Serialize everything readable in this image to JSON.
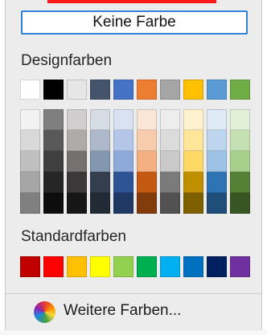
{
  "no_color_label": "Keine Farbe",
  "design_title": "Designfarben",
  "standard_title": "Standardfarben",
  "more_colors_label": "Weitere Farben...",
  "theme_colors": [
    {
      "name": "white",
      "base": "#ffffff",
      "shades": [
        "#f2f2f2",
        "#d9d9d9",
        "#bfbfbf",
        "#a6a6a6",
        "#808080"
      ]
    },
    {
      "name": "black",
      "base": "#000000",
      "shades": [
        "#7f7f7f",
        "#595959",
        "#3f3f3f",
        "#262626",
        "#0d0d0d"
      ]
    },
    {
      "name": "light-gray",
      "base": "#e7e6e6",
      "shades": [
        "#d0cece",
        "#aeabab",
        "#757171",
        "#3a3838",
        "#171616"
      ]
    },
    {
      "name": "dark-blue-gray",
      "base": "#44546a",
      "shades": [
        "#d6dce4",
        "#adb9ca",
        "#8497b0",
        "#333f4f",
        "#222b35"
      ]
    },
    {
      "name": "blue",
      "base": "#4472c4",
      "shades": [
        "#d9e2f3",
        "#b4c6e7",
        "#8eaadb",
        "#2f5496",
        "#1f3864"
      ]
    },
    {
      "name": "orange",
      "base": "#ed7d31",
      "shades": [
        "#fbe5d5",
        "#f7cbac",
        "#f4b083",
        "#c45911",
        "#823b0b"
      ]
    },
    {
      "name": "gray",
      "base": "#a5a5a5",
      "shades": [
        "#ededed",
        "#dbdbdb",
        "#c9c9c9",
        "#7b7b7b",
        "#525252"
      ]
    },
    {
      "name": "gold",
      "base": "#ffc000",
      "shades": [
        "#fff2cc",
        "#fee599",
        "#ffd965",
        "#bf8f00",
        "#7f6000"
      ]
    },
    {
      "name": "light-blue",
      "base": "#5b9bd5",
      "shades": [
        "#deeaf6",
        "#bdd6ee",
        "#9cc3e5",
        "#2e74b5",
        "#1e4e79"
      ]
    },
    {
      "name": "green",
      "base": "#70ad47",
      "shades": [
        "#e2efd9",
        "#c5e0b3",
        "#a8d08d",
        "#538135",
        "#375623"
      ]
    }
  ],
  "standard_colors": [
    {
      "name": "dark-red",
      "hex": "#c00000"
    },
    {
      "name": "red",
      "hex": "#ff0000"
    },
    {
      "name": "orange",
      "hex": "#ffc000"
    },
    {
      "name": "yellow",
      "hex": "#ffff00"
    },
    {
      "name": "light-green",
      "hex": "#92d050"
    },
    {
      "name": "green",
      "hex": "#00b050"
    },
    {
      "name": "light-blue",
      "hex": "#00b0f0"
    },
    {
      "name": "blue",
      "hex": "#0070c0"
    },
    {
      "name": "dark-blue",
      "hex": "#002060"
    },
    {
      "name": "purple",
      "hex": "#7030a0"
    }
  ],
  "accent": "#2e83d9"
}
